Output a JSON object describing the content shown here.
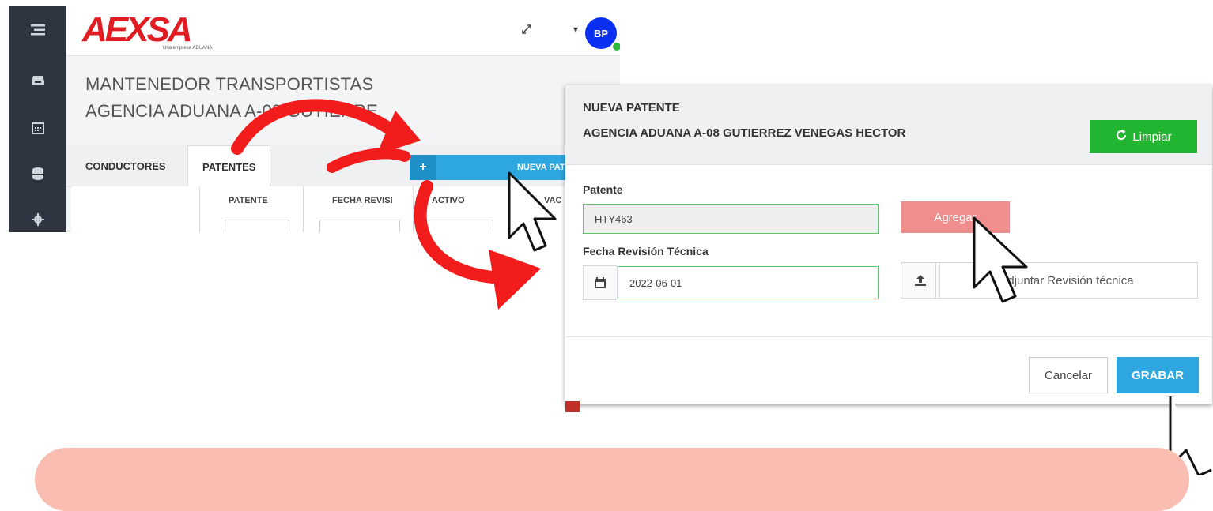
{
  "app": {
    "logo_text": "AEXSA",
    "logo_subtext": "Una empresa ADUANA",
    "user_initials": "BP",
    "page_title": "MANTENEDOR TRANSPORTISTAS",
    "page_subtitle": "AGENCIA ADUANA A-08 GUTIERRE",
    "tabs": [
      {
        "label": "CONDUCTORES",
        "active": false
      },
      {
        "label": "PATENTES",
        "active": true
      }
    ],
    "new_button": {
      "icon": "plus-icon",
      "label": "NUEVA PATENTE"
    },
    "table_headers": [
      "PATENTE",
      "FECHA REVISI",
      "ACTIVO",
      "VAC"
    ],
    "sidebar_icons": [
      "menu-icon",
      "inbox-icon",
      "calendar-icon",
      "database-icon",
      "gear-icon"
    ]
  },
  "modal": {
    "title": "NUEVA PATENTE",
    "subtitle": "AGENCIA ADUANA A-08 GUTIERREZ VENEGAS HECTOR",
    "clear_button": "Limpiar",
    "patente_label": "Patente",
    "patente_value": "HTY463",
    "add_button": "Agregar",
    "fecha_label": "Fecha Revisión Técnica",
    "fecha_value": "2022-06-01",
    "attach_label": "Adjuntar Revisión técnica",
    "cancel_button": "Cancelar",
    "save_button": "GRABAR"
  },
  "colors": {
    "brand_red": "#e01b22",
    "arrow_red": "#f21c1c",
    "primary_blue": "#2ea7e0",
    "success_green": "#21b531",
    "banner_pink": "#f9bdb2"
  }
}
